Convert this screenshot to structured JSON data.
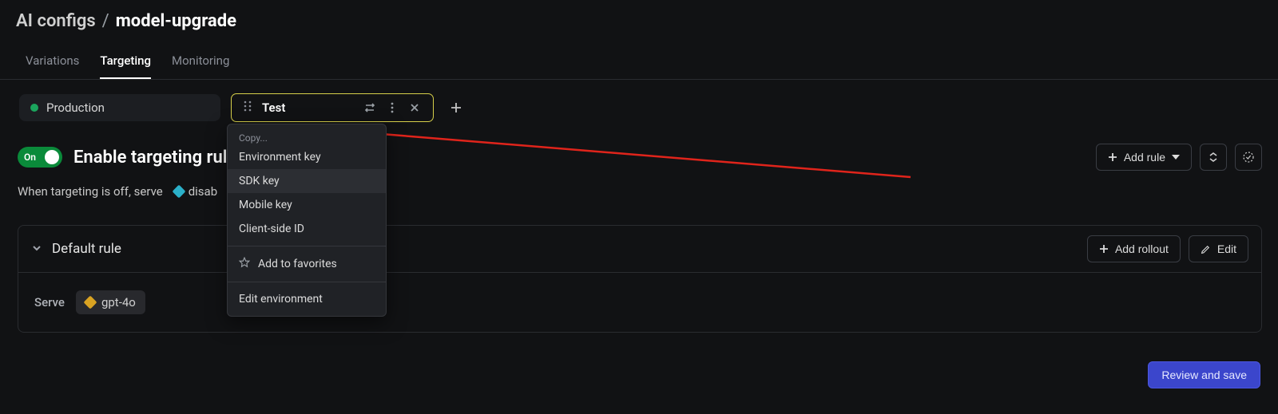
{
  "breadcrumb": {
    "parent": "AI configs",
    "sep": "/",
    "current": "model-upgrade"
  },
  "tabs": {
    "variations": "Variations",
    "targeting": "Targeting",
    "monitoring": "Monitoring"
  },
  "env": {
    "production": "Production",
    "test": "Test"
  },
  "targeting": {
    "toggle_label": "On",
    "title": "Enable targeting rule",
    "fallback_prefix": "When targeting is off, serve",
    "fallback_variation": "disab"
  },
  "actions": {
    "add_rule": "Add rule",
    "add_rollout": "Add rollout",
    "edit": "Edit"
  },
  "rule": {
    "title": "Default rule",
    "serve_label": "Serve",
    "serve_value": "gpt-4o"
  },
  "dropdown": {
    "heading": "Copy...",
    "env_key": "Environment key",
    "sdk_key": "SDK key",
    "mobile_key": "Mobile key",
    "client_id": "Client-side ID",
    "favorites": "Add to favorites",
    "edit_env": "Edit environment"
  },
  "footer": {
    "review": "Review and save"
  }
}
